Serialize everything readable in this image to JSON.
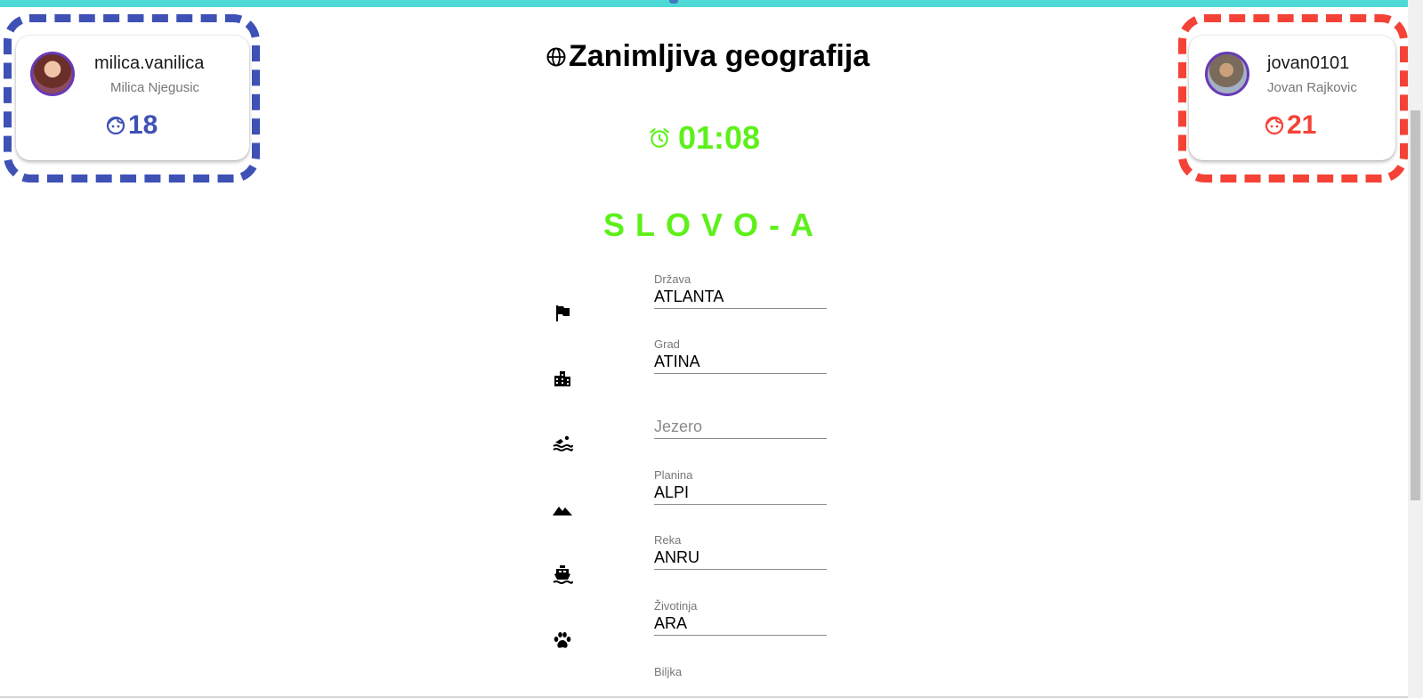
{
  "app": {
    "title": "Zanimljiva geografija"
  },
  "player1": {
    "username": "milica.vanilica",
    "full_name": "Milica Njegusic",
    "score": "18",
    "color": "#3f51b5"
  },
  "player2": {
    "username": "jovan0101",
    "full_name": "Jovan Rajkovic",
    "score": "21",
    "color": "#f44336"
  },
  "timer": {
    "value": "01:08",
    "color": "#5df01a"
  },
  "letter": {
    "text": "SLOVO-A"
  },
  "fields": [
    {
      "label": "Država",
      "value": "ATLANTA",
      "placeholder": "",
      "icon": "flag-icon"
    },
    {
      "label": "Grad",
      "value": "ATINA",
      "placeholder": "",
      "icon": "city-icon"
    },
    {
      "label": "",
      "value": "",
      "placeholder": "Jezero",
      "icon": "swimming-icon"
    },
    {
      "label": "Planina",
      "value": "ALPI",
      "placeholder": "",
      "icon": "mountain-icon"
    },
    {
      "label": "Reka",
      "value": "ANRU",
      "placeholder": "",
      "icon": "boat-icon"
    },
    {
      "label": "Životinja",
      "value": "ARA",
      "placeholder": "",
      "icon": "paw-icon"
    },
    {
      "label": "Biljka",
      "value": "",
      "placeholder": "",
      "icon": "plant-icon"
    }
  ]
}
